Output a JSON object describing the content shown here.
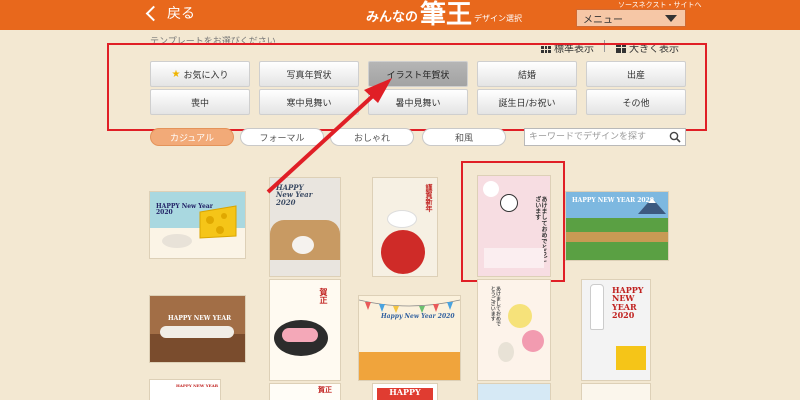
{
  "header": {
    "back_label": "戻る",
    "logo_prefix": "みんなの",
    "logo_main": "筆王",
    "logo_suffix": "デザイン選択",
    "top_link": "ソースネクスト・サイトへ",
    "menu_label": "メニュー"
  },
  "subheader": {
    "instruction": "テンプレートをお選びください",
    "view_standard": "標準表示",
    "view_large": "大きく表示"
  },
  "categories": [
    {
      "label": "お気に入り",
      "icon": "star-icon"
    },
    {
      "label": "写真年賀状"
    },
    {
      "label": "イラスト年賀状",
      "active": true
    },
    {
      "label": "結婚"
    },
    {
      "label": "出産"
    },
    {
      "label": "喪中"
    },
    {
      "label": "寒中見舞い"
    },
    {
      "label": "暑中見舞い"
    },
    {
      "label": "誕生日/お祝い"
    },
    {
      "label": "その他"
    }
  ],
  "style_tabs": [
    {
      "label": "カジュアル",
      "active": true
    },
    {
      "label": "フォーマル"
    },
    {
      "label": "おしゃれ"
    },
    {
      "label": "和風"
    }
  ],
  "search": {
    "placeholder": "キーワードでデザインを探す"
  },
  "cards": {
    "c1": "HAPPY New Year\n2020",
    "c2": "HAPPY\nNew Year\n2020",
    "c3": "謹賀新年",
    "c4": "あけましておめでとうございます",
    "c5": "HAPPY NEW YEAR 2020",
    "c6": "HAPPY NEW YEAR",
    "c7": "賀正",
    "c8": "Happy New Year 2020",
    "c9": "あけましておめでとうございます",
    "c10": "HAPPY\nNEW\nYEAR\n2020",
    "c11": "HAPPY NEW YEAR",
    "c12": "賀正",
    "c13": "HAPPY"
  },
  "colors": {
    "header": "#e8681c",
    "highlight": "#e01f26",
    "background": "#f3e8d2",
    "active_tab": "#f2aa78"
  }
}
